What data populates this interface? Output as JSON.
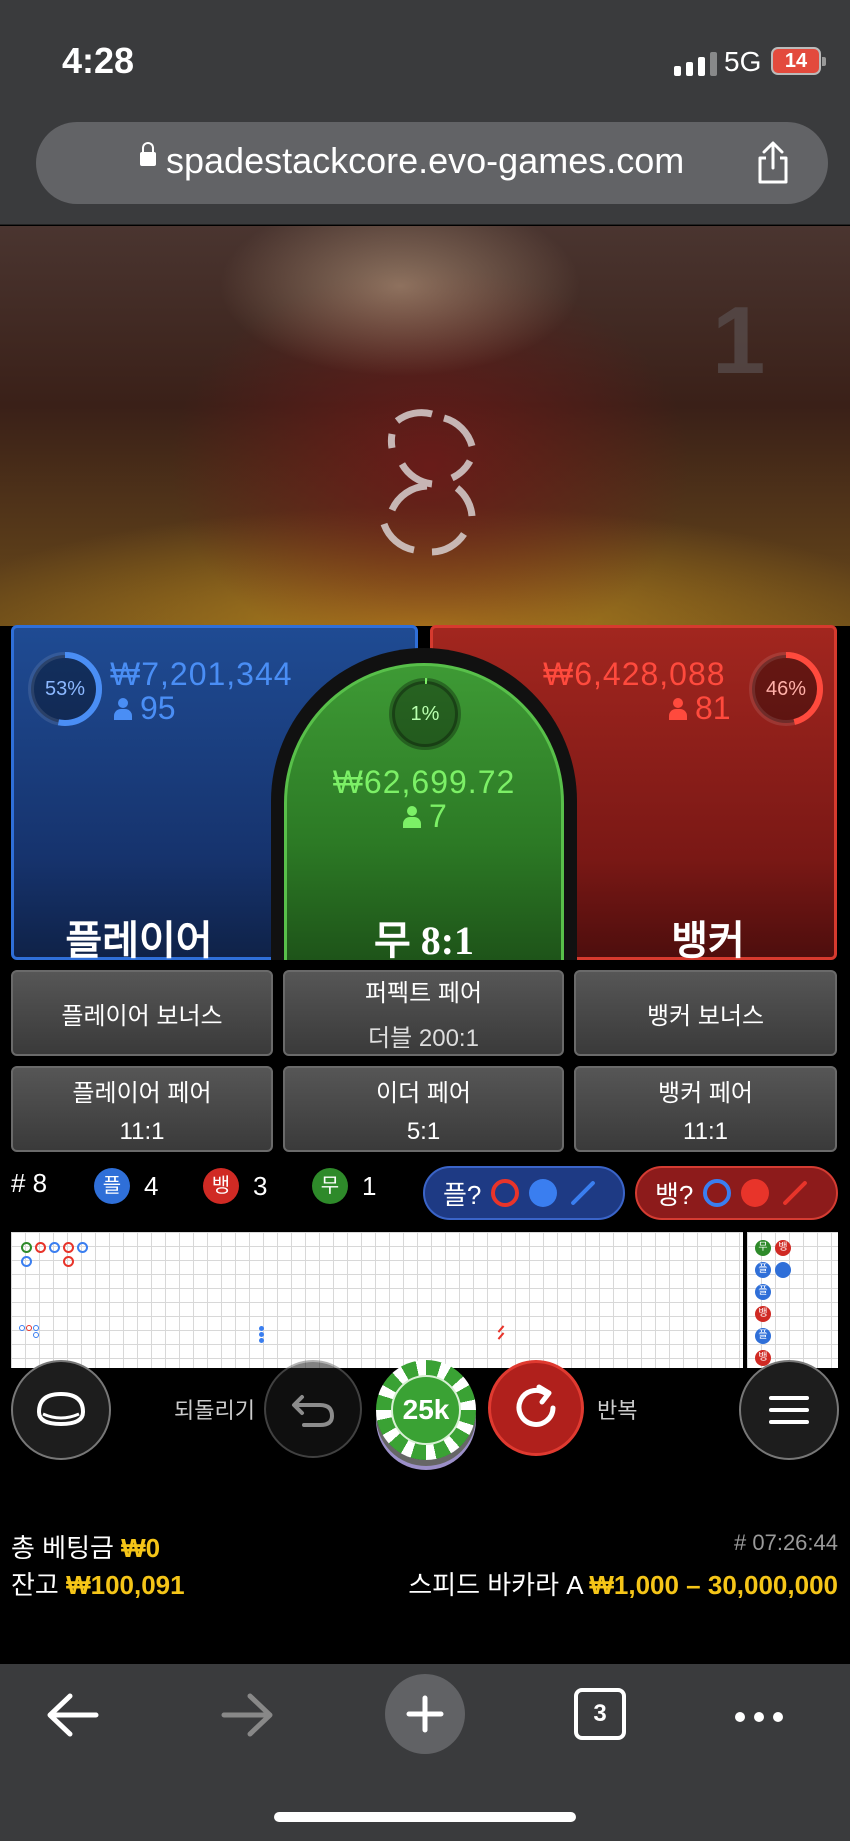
{
  "status_bar": {
    "time": "4:28",
    "network": "5G",
    "battery": "14"
  },
  "browser": {
    "url": "spadestackcore.evo-games.com"
  },
  "video": {
    "round_number": "1"
  },
  "bets": {
    "player": {
      "percent": "53%",
      "percent_value": 53,
      "amount": "₩7,201,344",
      "players": "95",
      "label": "플레이어",
      "color": "#4a8ef5"
    },
    "tie": {
      "percent": "1%",
      "percent_value": 1,
      "amount": "₩62,699.72",
      "players": "7",
      "label": "무 8:1",
      "color": "#7cf066"
    },
    "banker": {
      "percent": "46%",
      "percent_value": 46,
      "amount": "₩6,428,088",
      "players": "81",
      "label": "뱅커",
      "color": "#ff4a3d"
    }
  },
  "side_bets": {
    "player_bonus": "플레이어 보너스",
    "perfect_pair": {
      "title": "퍼펙트 페어",
      "payout": "더블 200:1"
    },
    "banker_bonus": "뱅커 보너스",
    "player_pair": {
      "title": "플레이어 페어",
      "payout": "11:1"
    },
    "either_pair": {
      "title": "이더 페어",
      "payout": "5:1"
    },
    "banker_pair": {
      "title": "뱅커 페어",
      "payout": "11:1"
    }
  },
  "stats": {
    "rounds": "# 8",
    "player_badge": "플",
    "player_count": "4",
    "banker_badge": "뱅",
    "banker_count": "3",
    "tie_badge": "무",
    "tie_count": "1"
  },
  "predictions": {
    "player": "플?",
    "banker": "뱅?"
  },
  "roadmap_side": [
    "무",
    "뱅",
    "플",
    "뱅",
    "플",
    "뱅",
    "플",
    "뱅"
  ],
  "controls": {
    "undo_label": "되돌리기",
    "chip_value": "25k",
    "repeat_label": "반복"
  },
  "totals": {
    "total_bet_label": "총 베팅금",
    "total_bet_value": "₩0",
    "balance_label": "잔고",
    "balance_value": "₩100,091",
    "game_id": "# 07:26:44",
    "table_name": "스피드 바카라 A",
    "limits": "₩1,000 – 30,000,000"
  },
  "toolbar": {
    "tab_count": "3"
  }
}
